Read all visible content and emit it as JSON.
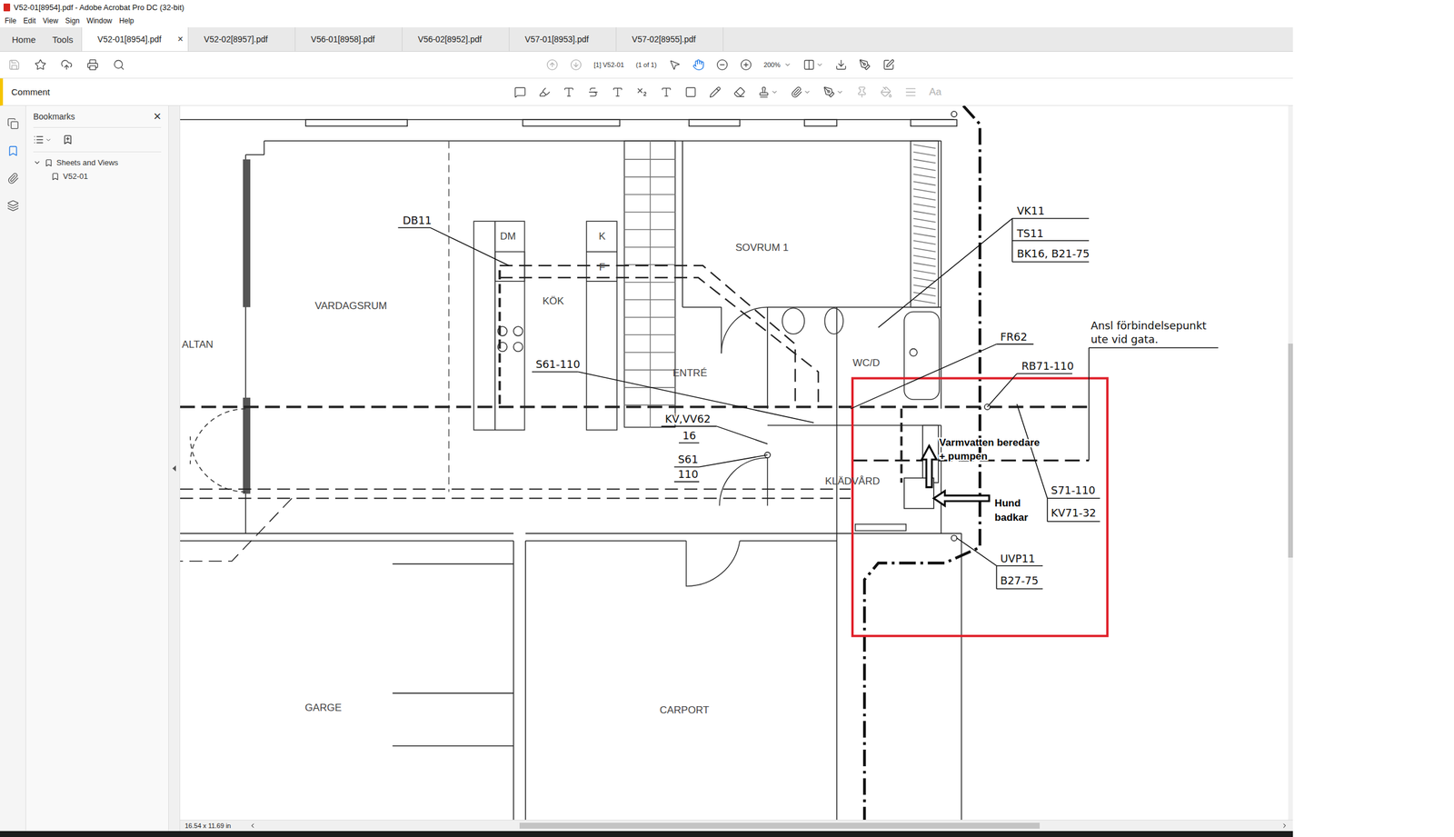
{
  "window": {
    "title": "V52-01[8954].pdf - Adobe Acrobat Pro DC (32-bit)"
  },
  "menu": [
    "File",
    "Edit",
    "View",
    "Sign",
    "Window",
    "Help"
  ],
  "nav_tabs": [
    {
      "label": "Home",
      "selected": false
    },
    {
      "label": "Tools",
      "selected": false
    }
  ],
  "doc_tabs": [
    {
      "label": "V52-01[8954].pdf",
      "selected": true
    },
    {
      "label": "V52-02[8957].pdf",
      "selected": false
    },
    {
      "label": "V56-01[8958].pdf",
      "selected": false
    },
    {
      "label": "V56-02[8952].pdf",
      "selected": false
    },
    {
      "label": "V57-01[8953].pdf",
      "selected": false
    },
    {
      "label": "V57-02[8955].pdf",
      "selected": false
    }
  ],
  "tab_close": "×",
  "toolbar": {
    "page": "[1] V52-01",
    "page_count": "(1 of 1)",
    "zoom": "200%",
    "prev_enabled": false,
    "next_enabled": false,
    "tools": [
      {
        "name": "select",
        "selected": false
      },
      {
        "name": "hand",
        "selected": true
      }
    ]
  },
  "comment_bar": {
    "title": "Comment",
    "font_button": "Aa",
    "formatting_enabled": false
  },
  "rail": [
    {
      "name": "pages",
      "selected": false
    },
    {
      "name": "bookmarks",
      "selected": true
    },
    {
      "name": "attachments",
      "selected": false
    },
    {
      "name": "layers",
      "selected": false
    }
  ],
  "bookmarks": {
    "title": "Bookmarks",
    "close": "×",
    "items": [
      {
        "label": "Sheets and Views",
        "expanded": true,
        "children": [
          {
            "label": "V52-01"
          }
        ]
      }
    ]
  },
  "drawing": {
    "rooms": [
      {
        "name": "VARDAGSRUM"
      },
      {
        "name": "KÖK"
      },
      {
        "name": "ENTRÉ"
      },
      {
        "name": "SOVRUM 1"
      },
      {
        "name": "WC/D"
      },
      {
        "name": "KLÄDVÅRD"
      },
      {
        "name": "GARGE"
      },
      {
        "name": "CARPORT"
      },
      {
        "name": "ALTAN"
      }
    ],
    "fixtures": [
      "DM",
      "K",
      "F"
    ],
    "tags": [
      {
        "lines": [
          "DB11"
        ]
      },
      {
        "lines": [
          "S61-110"
        ]
      },
      {
        "lines": [
          "KV,VV62",
          "16"
        ]
      },
      {
        "lines": [
          "S61",
          "110"
        ]
      },
      {
        "lines": [
          "VK11",
          "TS11",
          "BK16, B21-75"
        ]
      },
      {
        "lines": [
          "FR62"
        ]
      },
      {
        "lines": [
          "Ansl förbindelsepunkt",
          "ute vid gata."
        ]
      },
      {
        "lines": [
          "RB71-110"
        ]
      },
      {
        "lines": [
          "S71-110",
          "KV71-32"
        ]
      },
      {
        "lines": [
          "UVP11",
          "B27-75"
        ]
      }
    ],
    "notes": [
      {
        "lines": [
          "Varmvatten beredare",
          "+ pumpen"
        ]
      },
      {
        "lines": [
          "Hund",
          "badkar"
        ]
      }
    ]
  },
  "status": {
    "page_size": "16.54 x 11.69 in"
  }
}
